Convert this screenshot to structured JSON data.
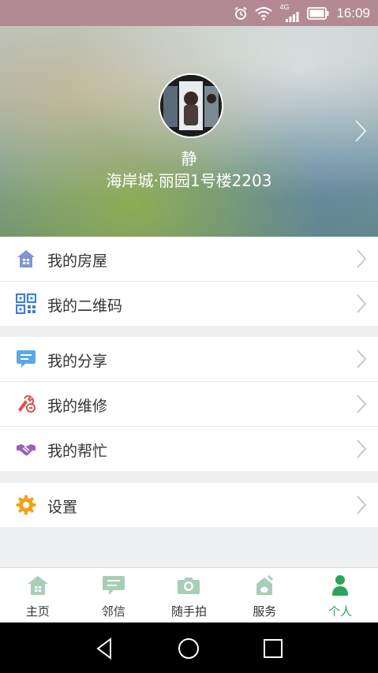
{
  "status_bar": {
    "time": "16:09",
    "network": "4G"
  },
  "profile": {
    "name": "静",
    "address": "海岸城·丽园1号楼2203"
  },
  "menu_groups": [
    [
      {
        "label": "我的房屋",
        "icon": "house-icon"
      },
      {
        "label": "我的二维码",
        "icon": "qr-code-icon"
      }
    ],
    [
      {
        "label": "我的分享",
        "icon": "chat-bubble-icon"
      },
      {
        "label": "我的维修",
        "icon": "repair-icon"
      },
      {
        "label": "我的帮忙",
        "icon": "handshake-icon"
      }
    ],
    [
      {
        "label": "设置",
        "icon": "gear-icon"
      }
    ]
  ],
  "tabs": [
    {
      "label": "主页",
      "icon": "home-icon",
      "active": false
    },
    {
      "label": "邻信",
      "icon": "message-icon",
      "active": false
    },
    {
      "label": "随手拍",
      "icon": "camera-icon",
      "active": false
    },
    {
      "label": "服务",
      "icon": "service-icon",
      "active": false
    },
    {
      "label": "个人",
      "icon": "person-icon",
      "active": true
    }
  ],
  "colors": {
    "status_bar": "#b38a93",
    "active_tab": "#2aa45b",
    "inactive_tab_icon": "#a8ceb6",
    "chevron": "#c8c8c8",
    "background": "#eef0f2"
  }
}
